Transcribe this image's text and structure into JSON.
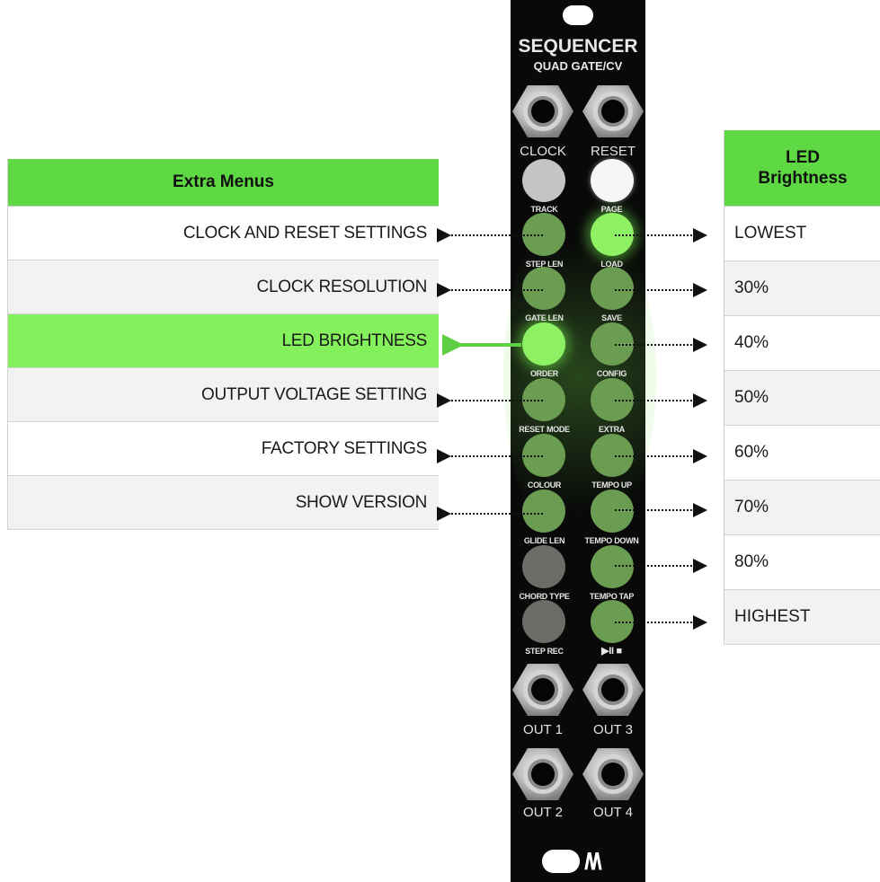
{
  "extra_menus": {
    "header": "Extra Menus",
    "items": [
      {
        "label": "CLOCK AND RESET SETTINGS",
        "style": "white"
      },
      {
        "label": "CLOCK RESOLUTION",
        "style": "alt"
      },
      {
        "label": "LED BRIGHTNESS",
        "style": "hl"
      },
      {
        "label": "OUTPUT VOLTAGE SETTING",
        "style": "alt"
      },
      {
        "label": "FACTORY SETTINGS",
        "style": "white"
      },
      {
        "label": "SHOW VERSION",
        "style": "alt"
      }
    ]
  },
  "led_brightness": {
    "header_line1": "LED",
    "header_line2": "Brightness",
    "items": [
      "LOWEST",
      "30%",
      "40%",
      "50%",
      "60%",
      "70%",
      "80%",
      "HIGHEST"
    ]
  },
  "module": {
    "title": "SEQUENCER",
    "subtitle": "QUAD GATE/CV",
    "jacks_top": [
      "CLOCK",
      "RESET"
    ],
    "button_labels_left": [
      "TRACK",
      "STEP LEN",
      "GATE LEN",
      "ORDER",
      "RESET MODE",
      "COLOUR",
      "GLIDE LEN",
      "CHORD TYPE",
      "STEP REC"
    ],
    "button_labels_right": [
      "PAGE",
      "LOAD",
      "SAVE",
      "CONFIG",
      "EXTRA",
      "TEMPO UP",
      "TEMPO DOWN",
      "TEMPO TAP",
      "▶II ■"
    ],
    "jacks_bottom": [
      "OUT 1",
      "OUT 3",
      "OUT 2",
      "OUT 4"
    ],
    "logo": "/\\/\\"
  },
  "colors": {
    "header_green": "#5ed843",
    "highlight_green": "#84f05c",
    "arrow_green": "#5fcf45",
    "panel_black": "#090909"
  }
}
